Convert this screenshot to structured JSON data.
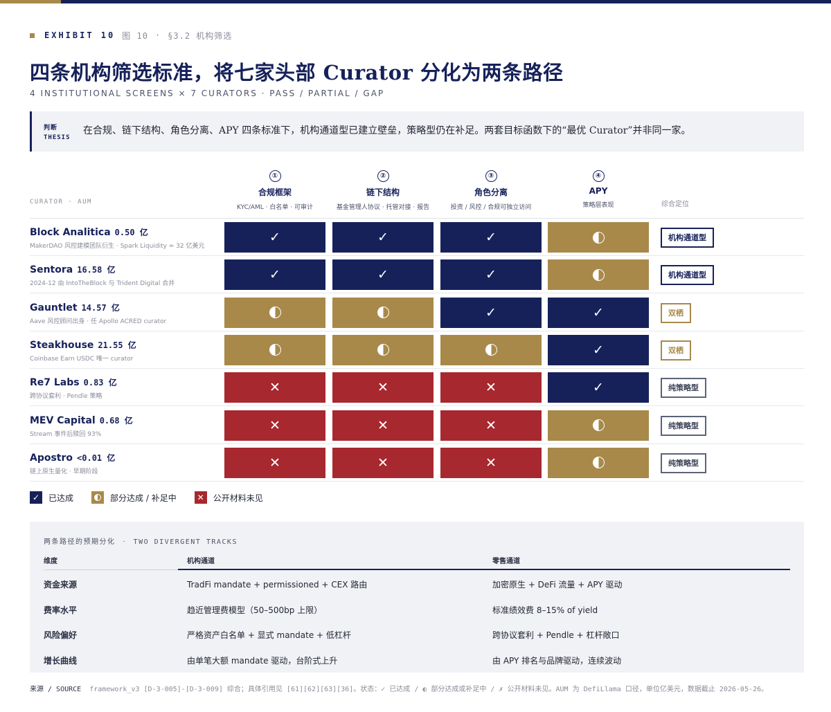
{
  "exhibit": {
    "label": "EXHIBIT 10",
    "figure": "图 10",
    "dot": "·",
    "section": "§3.2 机构筛选"
  },
  "title": "四条机构筛选标准，将七家头部 Curator 分化为两条路径",
  "subtitle": "4 INSTITUTIONAL SCREENS × 7 CURATORS · PASS / PARTIAL / GAP",
  "thesis": {
    "tag_cn": "判断",
    "tag_en": "THESIS",
    "text": "在合规、链下结构、角色分离、APY 四条标准下，机构通道型已建立壁垒，策略型仍在补足。两套目标函数下的“最优 Curator”并非同一家。"
  },
  "header": {
    "curator": "CURATOR · AUM",
    "positioning": "综合定位"
  },
  "criteria": [
    {
      "num": "①",
      "title": "合规框架",
      "sub": "KYC/AML · 白名单 · 可审计"
    },
    {
      "num": "②",
      "title": "链下结构",
      "sub": "基金管理人协议 · 托管对接 · 报告"
    },
    {
      "num": "③",
      "title": "角色分离",
      "sub": "投资 / 风控 / 合规可独立访问"
    },
    {
      "num": "④",
      "title": "APY",
      "sub": "策略层表现"
    }
  ],
  "symbols": {
    "pass": "✓",
    "gap": "✕"
  },
  "rows": [
    {
      "name": "Block Analitica",
      "aum": "0.50 亿",
      "note": "MakerDAO 风控建模团队衍生 · Spark Liquidity ≈ 32 亿美元",
      "status": [
        "pass",
        "pass",
        "pass",
        "partial"
      ],
      "position": "机构通道型",
      "type": "inst"
    },
    {
      "name": "Sentora",
      "aum": "16.58 亿",
      "note": "2024-12 由 IntoTheBlock 与 Trident Digital 合并",
      "status": [
        "pass",
        "pass",
        "pass",
        "partial"
      ],
      "position": "机构通道型",
      "type": "inst"
    },
    {
      "name": "Gauntlet",
      "aum": "14.57 亿",
      "note": "Aave 风控顾问出身 · 任 Apollo ACRED curator",
      "status": [
        "partial",
        "partial",
        "pass",
        "pass"
      ],
      "position": "双栖",
      "type": "dual"
    },
    {
      "name": "Steakhouse",
      "aum": "21.55 亿",
      "note": "Coinbase Earn USDC 唯一 curator",
      "status": [
        "partial",
        "partial",
        "partial",
        "pass"
      ],
      "position": "双栖",
      "type": "dual"
    },
    {
      "name": "Re7 Labs",
      "aum": "0.83 亿",
      "note": "跨协议套利 · Pendle 策略",
      "status": [
        "gap",
        "gap",
        "gap",
        "pass"
      ],
      "position": "纯策略型",
      "type": "pure"
    },
    {
      "name": "MEV Capital",
      "aum": "0.68 亿",
      "note": "Stream 事件后赎回 93%",
      "status": [
        "gap",
        "gap",
        "gap",
        "partial"
      ],
      "position": "纯策略型",
      "type": "pure"
    },
    {
      "name": "Apostro",
      "aum": "<0.01 亿",
      "note": "链上原生量化 · 早期阶段",
      "status": [
        "gap",
        "gap",
        "gap",
        "partial"
      ],
      "position": "纯策略型",
      "type": "pure"
    }
  ],
  "legend": {
    "pass": "已达成",
    "partial": "部分达成 / 补足中",
    "gap": "公开材料未见"
  },
  "tracks": {
    "title_cn": "两条路径的预期分化",
    "title_sep": "·",
    "title_en": "TWO DIVERGENT TRACKS",
    "headers": [
      "维度",
      "机构通道",
      "零售通道"
    ],
    "rows": [
      [
        "资金来源",
        "TradFi mandate + permissioned + CEX 路由",
        "加密原生 + DeFi 流量 + APY 驱动"
      ],
      [
        "费率水平",
        "趋近管理费模型（50–500bp 上限）",
        "标准绩效费 8–15% of yield"
      ],
      [
        "风险偏好",
        "严格资产白名单 + 显式 mandate + 低杠杆",
        "跨协议套利 + Pendle + 杠杆敞口"
      ],
      [
        "增长曲线",
        "由单笔大额 mandate 驱动，台阶式上升",
        "由 APY 排名与品牌驱动，连续波动"
      ]
    ]
  },
  "source": {
    "label": "来源 / SOURCE",
    "text": "framework_v3 [D-3-005]-[D-3-009] 综合；具体引用见 [61][62][63][36]。状态：✓ 已达成 / ◐ 部分达成或补足中 / ✗ 公开材料未见。AUM 为 DefiLlama 口径，单位亿美元，数据截止 2026-05-26。"
  },
  "colors": {
    "navy": "#16215a",
    "gold": "#a8894a",
    "red": "#a7282f"
  }
}
